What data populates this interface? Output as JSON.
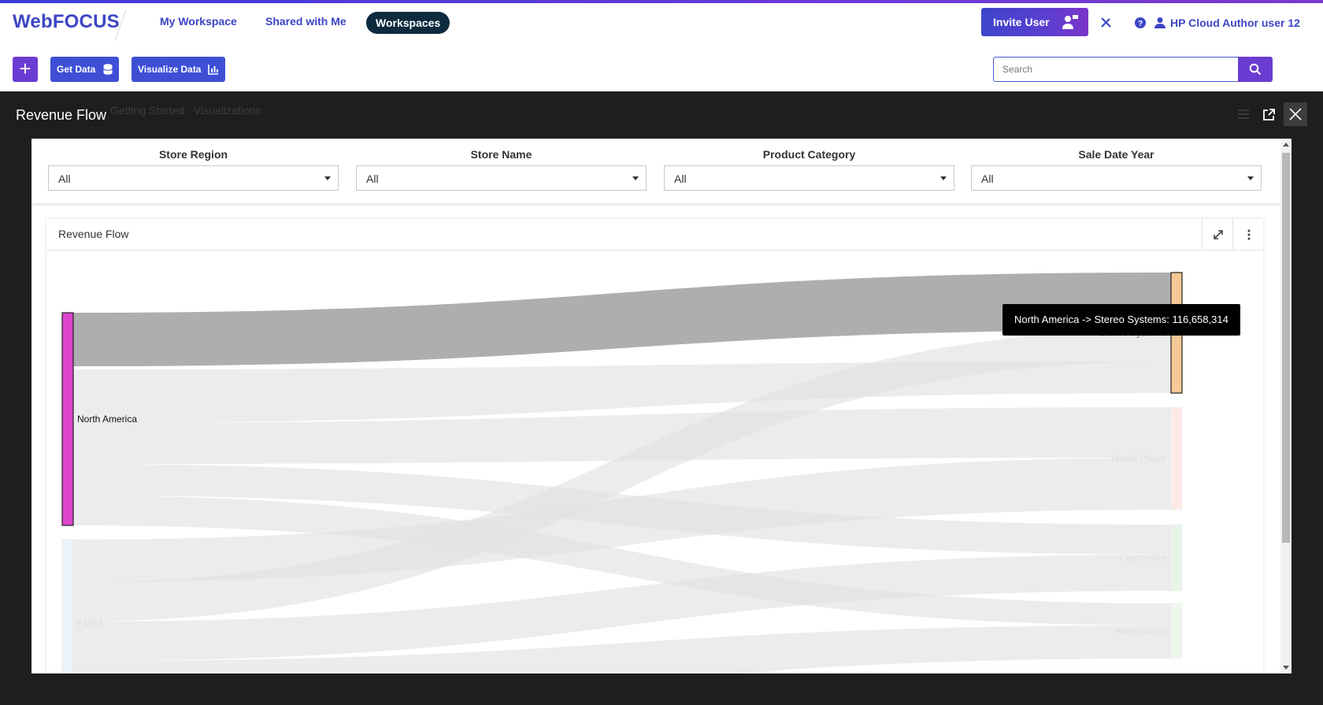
{
  "app": {
    "logo": "WebFOCUS",
    "nav": [
      "My Workspace",
      "Shared with Me"
    ],
    "nav_active": "Workspaces",
    "invite_label": "Invite User",
    "user_name": "HP Cloud Author user 12"
  },
  "toolbar": {
    "get_data_label": "Get Data",
    "visualize_label": "Visualize Data",
    "search_placeholder": "Search"
  },
  "breadcrumb": [
    "Getting Started",
    "Visualizations"
  ],
  "modal": {
    "title": "Revenue Flow",
    "filters": [
      {
        "label": "Store Region",
        "value": "All"
      },
      {
        "label": "Store Name",
        "value": "All"
      },
      {
        "label": "Product Category",
        "value": "All"
      },
      {
        "label": "Sale Date Year",
        "value": "All"
      }
    ],
    "panel_title": "Revenue Flow",
    "tooltip": "North America -> Stereo Systems: 116,658,314"
  },
  "chart_data": {
    "type": "sankey",
    "sources": [
      "North America",
      "EMEA"
    ],
    "targets": [
      "Stereo Systems",
      "Media Player",
      "Camcorder",
      "Accessories"
    ],
    "highlighted_link": {
      "source": "North America",
      "target": "Stereo Systems",
      "value": 116658314
    },
    "colors": {
      "North America": "#dd44cc",
      "EMEA": "#e6f0f7",
      "Stereo Systems": "#f5c996",
      "Media Player": "#fde4df",
      "Camcorder": "#dff2df",
      "Accessories": "#e8f5e6",
      "link_highlight": "#aaaaaa",
      "link_dim": "#e2e2e2"
    }
  }
}
